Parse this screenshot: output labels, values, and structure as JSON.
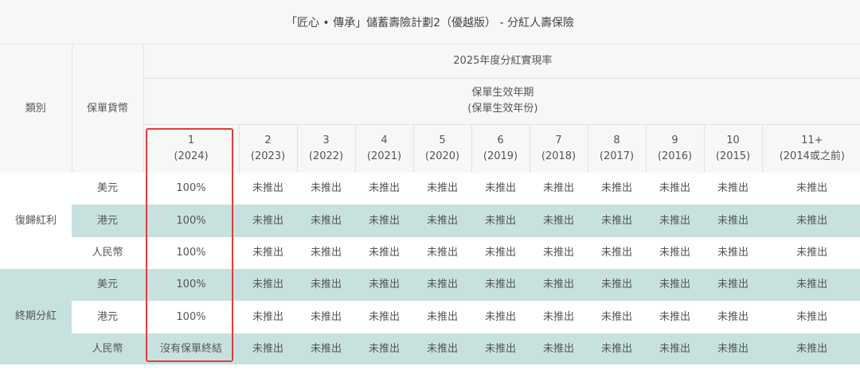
{
  "title": "「匠心 • 傳承」儲蓄壽險計劃2（優越版） - 分紅人壽保險",
  "header": {
    "category_label": "類別",
    "currency_label": "保單貨幣",
    "realization_label": "2025年度分紅實現率",
    "policy_year_label": "保單生效年期",
    "policy_year_sub": "(保單生效年份)"
  },
  "years": [
    {
      "year": "1",
      "label": "(2024)"
    },
    {
      "year": "2",
      "label": "(2023)"
    },
    {
      "year": "3",
      "label": "(2022)"
    },
    {
      "year": "4",
      "label": "(2021)"
    },
    {
      "year": "5",
      "label": "(2020)"
    },
    {
      "year": "6",
      "label": "(2019)"
    },
    {
      "year": "7",
      "label": "(2018)"
    },
    {
      "year": "8",
      "label": "(2017)"
    },
    {
      "year": "9",
      "label": "(2016)"
    },
    {
      "year": "10",
      "label": "(2015)"
    },
    {
      "year": "11+",
      "label": "(2014或之前)"
    }
  ],
  "groups": [
    {
      "category": "復歸紅利",
      "rows": [
        {
          "currency": "美元",
          "cells": [
            "100%",
            "未推出",
            "未推出",
            "未推出",
            "未推出",
            "未推出",
            "未推出",
            "未推出",
            "未推出",
            "未推出",
            "未推出"
          ]
        },
        {
          "currency": "港元",
          "cells": [
            "100%",
            "未推出",
            "未推出",
            "未推出",
            "未推出",
            "未推出",
            "未推出",
            "未推出",
            "未推出",
            "未推出",
            "未推出"
          ]
        },
        {
          "currency": "人民幣",
          "cells": [
            "100%",
            "未推出",
            "未推出",
            "未推出",
            "未推出",
            "未推出",
            "未推出",
            "未推出",
            "未推出",
            "未推出",
            "未推出"
          ]
        }
      ]
    },
    {
      "category": "終期分紅",
      "rows": [
        {
          "currency": "美元",
          "cells": [
            "100%",
            "未推出",
            "未推出",
            "未推出",
            "未推出",
            "未推出",
            "未推出",
            "未推出",
            "未推出",
            "未推出",
            "未推出"
          ]
        },
        {
          "currency": "港元",
          "cells": [
            "100%",
            "未推出",
            "未推出",
            "未推出",
            "未推出",
            "未推出",
            "未推出",
            "未推出",
            "未推出",
            "未推出",
            "未推出"
          ]
        },
        {
          "currency": "人民幣",
          "cells": [
            "沒有保單終結",
            "未推出",
            "未推出",
            "未推出",
            "未推出",
            "未推出",
            "未推出",
            "未推出",
            "未推出",
            "未推出",
            "未推出"
          ]
        }
      ]
    }
  ],
  "colors": {
    "header_bg": "#f7f7f6",
    "teal_row": "#c7e2de",
    "highlight_border": "#e23b3b"
  }
}
